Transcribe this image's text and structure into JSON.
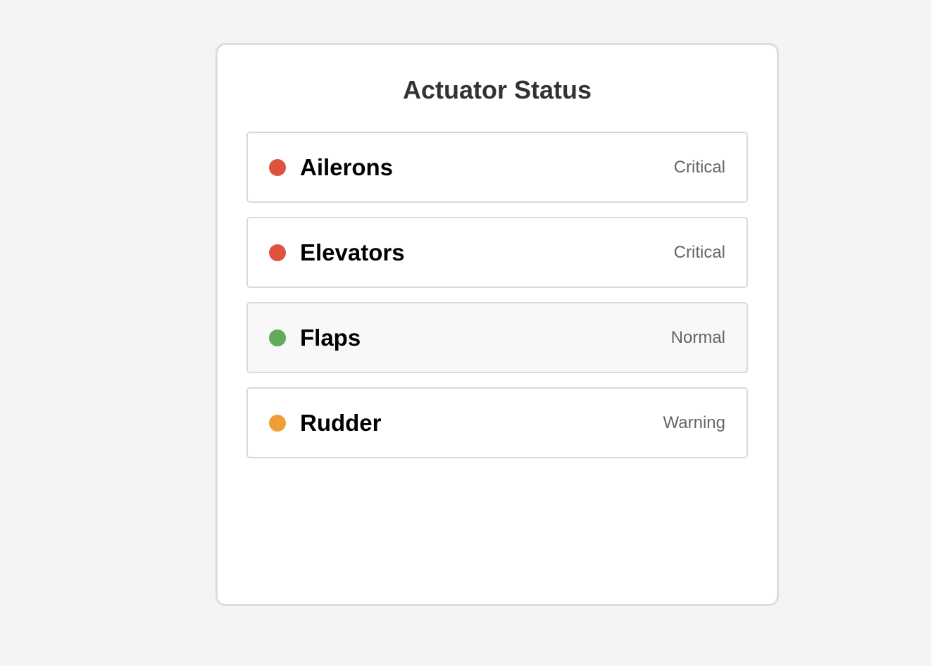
{
  "panel": {
    "title": "Actuator Status"
  },
  "status_colors": {
    "Critical": "#e05240",
    "Normal": "#63ab5a",
    "Warning": "#f09d38"
  },
  "actuators": [
    {
      "name": "Ailerons",
      "status": "Critical",
      "status_icon": "red-status-dot",
      "highlighted": false
    },
    {
      "name": "Elevators",
      "status": "Critical",
      "status_icon": "red-status-dot",
      "highlighted": false
    },
    {
      "name": "Flaps",
      "status": "Normal",
      "status_icon": "green-status-dot",
      "highlighted": true
    },
    {
      "name": "Rudder",
      "status": "Warning",
      "status_icon": "orange-status-dot",
      "highlighted": false
    }
  ]
}
